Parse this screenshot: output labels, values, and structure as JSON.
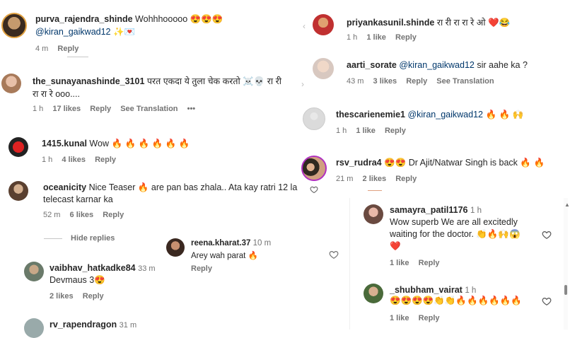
{
  "left": {
    "c1": {
      "user": "purva_rajendra_shinde",
      "text": "Wohhhooooo 😍😍😍",
      "mention": "@kiran_gaikwad12",
      "after": "✨💌",
      "time": "4 m",
      "reply": "Reply"
    },
    "c2": {
      "user": "the_sunayanashinde_3101",
      "text": "परत एकदा ये तुला चेक करतो ☠️💀 रा री",
      "text2": "रा रा रे ooo....",
      "time": "1 h",
      "likes": "17 likes",
      "reply": "Reply",
      "translate": "See Translation",
      "more": "•••"
    },
    "c3": {
      "user": "1415.kunal",
      "text": "Wow 🔥 🔥 🔥 🔥 🔥 🔥",
      "time": "1 h",
      "likes": "4 likes",
      "reply": "Reply"
    },
    "c4": {
      "user": "oceanicity",
      "text": "Nice Teaser 🔥 are pan bas zhala.. Ata kay ratri 12 la",
      "text2": "telecast karnar ka",
      "time": "52 m",
      "likes": "6 likes",
      "reply": "Reply"
    },
    "hide": "Hide replies",
    "c5": {
      "user": "vaibhav_hatkadke84",
      "time_inline": "33 m",
      "text": "Devmaus 3😍",
      "likes": "2 likes",
      "reply": "Reply"
    },
    "c6": {
      "user": "rv_rapendragon",
      "time_inline": "31 m"
    }
  },
  "popup": {
    "user": "reena.kharat.37",
    "time_inline": "10 m",
    "text": "Arey wah parat 🔥",
    "reply": "Reply"
  },
  "right": {
    "c1": {
      "user": "priyankasunil.shinde",
      "text": "रा री रा रा रे ओ ❤️😂",
      "time": "1 h",
      "likes": "1 like",
      "reply": "Reply"
    },
    "c2": {
      "user": "aarti_sorate",
      "mention": "@kiran_gaikwad12",
      "text": "sir aahe ka ?",
      "time": "43 m",
      "likes": "3 likes",
      "reply": "Reply",
      "translate": "See Translation"
    },
    "c3": {
      "user": "thescarienemie1",
      "mention": "@kiran_gaikwad12",
      "text": "🔥 🔥 🙌",
      "time": "1 h",
      "likes": "1 like",
      "reply": "Reply"
    },
    "c4": {
      "user": "rsv_rudra4",
      "text": "😍😍 Dr Ajit/Natwar Singh is back 🔥 🔥",
      "time": "21 m",
      "likes": "2 likes",
      "reply": "Reply"
    },
    "r1": {
      "user": "samayra_patil1176",
      "time_inline": "1 h",
      "text": "Wow superb We are all excitedly",
      "text2": "waiting for the doctor. 👏🔥🙌😱",
      "text3": "❤️",
      "likes": "1 like",
      "reply": "Reply"
    },
    "r2": {
      "user": "_shubham_vairat",
      "time_inline": "1 h",
      "text": "😍😍😍😍👏👏🔥🔥🔥🔥🔥🔥",
      "likes": "1 like",
      "reply": "Reply"
    }
  },
  "icons": [
    "heart-outline-icon",
    "fire-emoji",
    "ellipsis-icon"
  ]
}
